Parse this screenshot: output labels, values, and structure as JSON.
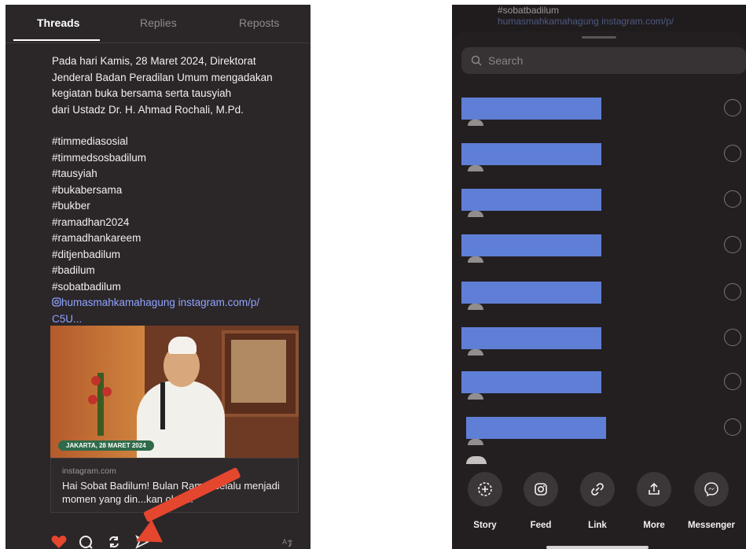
{
  "left": {
    "tabs": [
      {
        "label": "Threads",
        "active": true
      },
      {
        "label": "Replies",
        "active": false
      },
      {
        "label": "Reposts",
        "active": false
      }
    ],
    "post": {
      "lines": [
        "Pada hari Kamis, 28 Maret 2024, Direktorat",
        "Jenderal Badan Peradilan Umum mengadakan",
        "kegiatan buka bersama serta tausyiah",
        "dari Ustadz Dr. H. Ahmad Rochali, M.Pd."
      ],
      "hashtags": [
        "#timmediasosial",
        "#timmedsosbadilum",
        "#tausyiah",
        "#bukabersama",
        "#bukber",
        "#ramadhan2024",
        "#ramadhankareem",
        "#ditjenbadilum",
        "#badilum",
        "#sobatbadilum"
      ],
      "link_line1": "humasmahkamahagung instagram.com/p/",
      "link_line2": "C5U..."
    },
    "media_badge": "JAKARTA, 28 MARET 2024",
    "link_card": {
      "domain": "instagram.com",
      "text": "Hai Sobat Badilum!  Bulan Ram... selalu menjadi momen yang din...kan oleh..."
    },
    "translate_icon": "translate-icon",
    "colors": {
      "like": "#e5462e",
      "arrow": "#e5462e"
    }
  },
  "right": {
    "peek": {
      "line1": "#sobatbadilum",
      "line2": "humasmahkamahagung instagram.com/p/"
    },
    "search": {
      "placeholder": "Search"
    },
    "contacts_count": 8,
    "share_options": [
      {
        "label": "Story",
        "icon": "story-add-icon"
      },
      {
        "label": "Feed",
        "icon": "instagram-icon"
      },
      {
        "label": "Link",
        "icon": "link-icon"
      },
      {
        "label": "More",
        "icon": "share-upload-icon"
      },
      {
        "label": "Messenger",
        "icon": "messenger-icon"
      }
    ],
    "colors": {
      "redaction": "#5f7fd6"
    }
  }
}
